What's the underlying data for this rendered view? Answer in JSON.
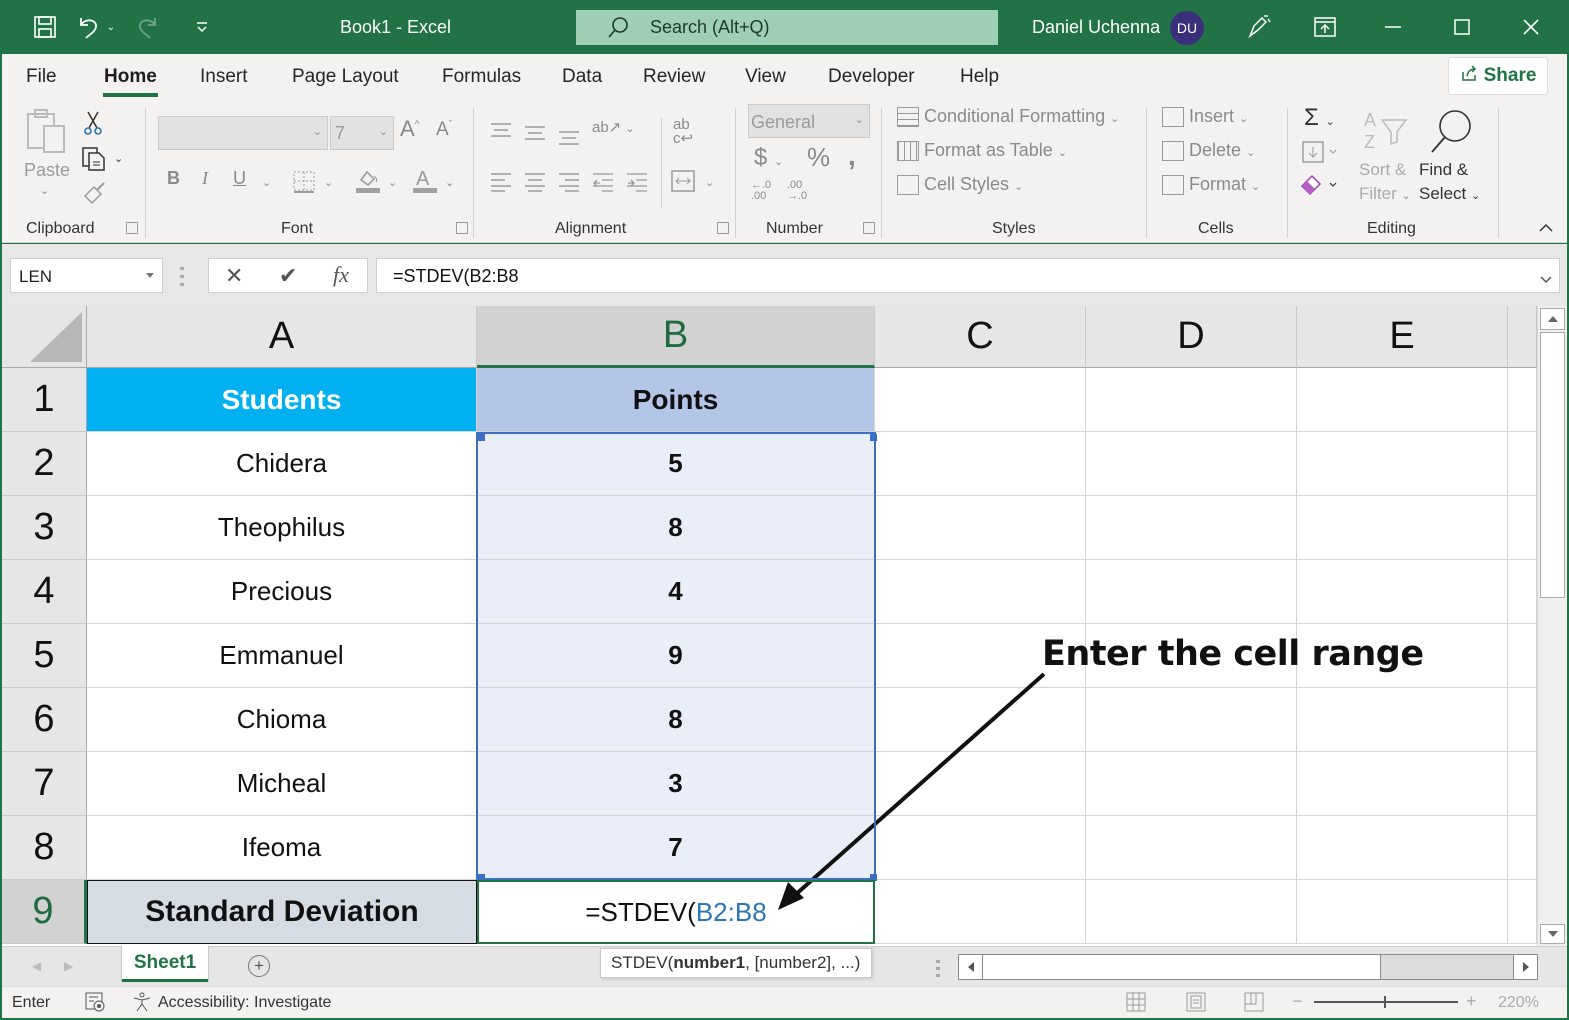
{
  "titlebar": {
    "title": "Book1  -  Excel",
    "search_placeholder": "Search (Alt+Q)",
    "user_name": "Daniel Uchenna",
    "user_initials": "DU"
  },
  "ribbon_tabs": [
    "File",
    "Home",
    "Insert",
    "Page Layout",
    "Formulas",
    "Data",
    "Review",
    "View",
    "Developer",
    "Help"
  ],
  "active_tab": "Home",
  "share_label": "Share",
  "ribbon": {
    "clipboard": {
      "label": "Clipboard",
      "paste": "Paste"
    },
    "font": {
      "label": "Font",
      "font_name": "",
      "font_size": "7"
    },
    "alignment": {
      "label": "Alignment"
    },
    "number": {
      "label": "Number",
      "format": "General"
    },
    "styles": {
      "label": "Styles",
      "conditional_formatting": "Conditional Formatting",
      "format_as_table": "Format as Table",
      "cell_styles": "Cell Styles"
    },
    "cells": {
      "label": "Cells",
      "insert": "Insert",
      "delete": "Delete",
      "format": "Format"
    },
    "editing": {
      "label": "Editing",
      "sort_filter_1": "Sort &",
      "sort_filter_2": "Filter",
      "find_select_1": "Find &",
      "find_select_2": "Select"
    }
  },
  "formula_bar": {
    "name_box": "LEN",
    "cancel_icon": "✕",
    "enter_icon": "✔",
    "fx_label": "fx",
    "formula": "=STDEV(B2:B8"
  },
  "grid": {
    "columns": [
      "A",
      "B",
      "C",
      "D",
      "E"
    ],
    "rows": [
      "1",
      "2",
      "3",
      "4",
      "5",
      "6",
      "7",
      "8",
      "9"
    ],
    "header": {
      "a": "Students",
      "b": "Points"
    },
    "data": [
      {
        "student": "Chidera",
        "points": "5"
      },
      {
        "student": "Theophilus",
        "points": "8"
      },
      {
        "student": "Precious",
        "points": "4"
      },
      {
        "student": "Emmanuel",
        "points": "9"
      },
      {
        "student": "Chioma",
        "points": "8"
      },
      {
        "student": "Micheal",
        "points": "3"
      },
      {
        "student": "Ifeoma",
        "points": "7"
      }
    ],
    "footer": {
      "label": "Standard Deviation",
      "formula_prefix": "=STDEV(",
      "formula_range": "B2:B8"
    }
  },
  "colors": {
    "excel_green": "#217346",
    "students_header_bg": "#00b0f0",
    "points_header_bg": "#b4c6e7",
    "range_fill": "#e9eef8",
    "footer_label_bg": "#d6dce4",
    "range_ref": "#2e75b6"
  },
  "tooltip": {
    "prefix": "STDEV(",
    "bold_arg": "number1",
    "rest": ", [number2], ...)"
  },
  "annotation": "Enter the cell range",
  "sheet_tabs": [
    "Sheet1"
  ],
  "status": {
    "mode": "Enter",
    "accessibility": "Accessibility: Investigate",
    "zoom": "220%"
  }
}
